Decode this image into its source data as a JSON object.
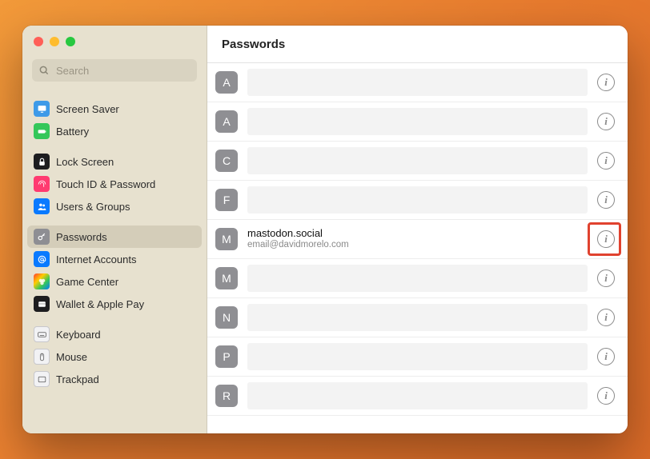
{
  "header": {
    "title": "Passwords"
  },
  "search": {
    "placeholder": "Search"
  },
  "sidebar": {
    "groups": [
      {
        "items": [
          {
            "label": "Screen Saver",
            "iconClass": "ic-blue",
            "iconName": "screensaver-icon",
            "svg": "monitor"
          },
          {
            "label": "Battery",
            "iconClass": "ic-green",
            "iconName": "battery-icon",
            "svg": "battery"
          }
        ]
      },
      {
        "items": [
          {
            "label": "Lock Screen",
            "iconClass": "ic-black",
            "iconName": "lock-icon",
            "svg": "lock"
          },
          {
            "label": "Touch ID & Password",
            "iconClass": "ic-pink",
            "iconName": "fingerprint-icon",
            "svg": "fingerprint"
          },
          {
            "label": "Users & Groups",
            "iconClass": "ic-blue2",
            "iconName": "users-icon",
            "svg": "users"
          }
        ]
      },
      {
        "items": [
          {
            "label": "Passwords",
            "iconClass": "ic-grey",
            "iconName": "key-icon",
            "svg": "key",
            "selected": true
          },
          {
            "label": "Internet Accounts",
            "iconClass": "ic-blue2",
            "iconName": "at-icon",
            "svg": "at"
          },
          {
            "label": "Game Center",
            "iconClass": "ic-gamecenter",
            "iconName": "gamecenter-icon",
            "svg": "circles"
          },
          {
            "label": "Wallet & Apple Pay",
            "iconClass": "ic-black",
            "iconName": "wallet-icon",
            "svg": "wallet"
          }
        ]
      },
      {
        "items": [
          {
            "label": "Keyboard",
            "iconClass": "ic-white",
            "iconName": "keyboard-icon",
            "svg": "keyboard"
          },
          {
            "label": "Mouse",
            "iconClass": "ic-white",
            "iconName": "mouse-icon",
            "svg": "mouse"
          },
          {
            "label": "Trackpad",
            "iconClass": "ic-white",
            "iconName": "trackpad-icon",
            "svg": "trackpad"
          }
        ]
      }
    ]
  },
  "password_rows": [
    {
      "letter": "A",
      "redacted": true
    },
    {
      "letter": "A",
      "redacted": true
    },
    {
      "letter": "C",
      "redacted": true
    },
    {
      "letter": "F",
      "redacted": true
    },
    {
      "letter": "M",
      "redacted": false,
      "site": "mastodon.social",
      "user": "email@davidmorelo.com",
      "highlighted": true
    },
    {
      "letter": "M",
      "redacted": true
    },
    {
      "letter": "N",
      "redacted": true
    },
    {
      "letter": "P",
      "redacted": true
    },
    {
      "letter": "R",
      "redacted": true
    }
  ],
  "info_glyph": "i"
}
